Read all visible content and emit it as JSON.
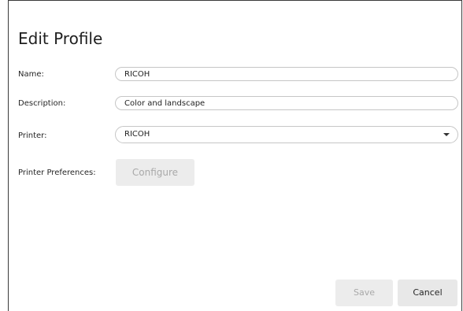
{
  "dialog": {
    "title": "Edit Profile"
  },
  "form": {
    "name": {
      "label": "Name:",
      "value": "RICOH"
    },
    "description": {
      "label": "Description:",
      "value": "Color and landscape"
    },
    "printer": {
      "label": "Printer:",
      "selected": "RICOH"
    },
    "preferences": {
      "label": "Printer Preferences:",
      "button_label": "Configure"
    }
  },
  "footer": {
    "save_label": "Save",
    "cancel_label": "Cancel"
  }
}
